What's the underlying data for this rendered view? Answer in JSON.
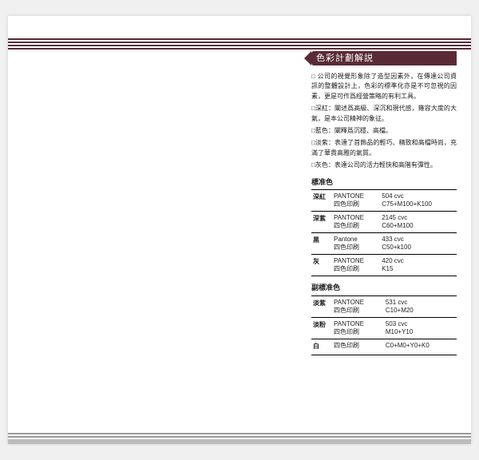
{
  "title": "色彩計劃解説",
  "intro": [
    "□ 公司的視覺形象除了造型因素外，在傳達公司資訊的整體設計上，色彩的標準化亦是不可忽視的因素，更是可作爲經營策略的有利工具。",
    "□深紅：闡述爲高級、深沉和現代感，雍容大度的大氣，是本公司精神的象征。",
    "□藍色：闡釋爲沉穩、高檔。",
    "□淡紫：表達了首飾品的輕巧、精致和高檔時尚，充滿了華貴高雅的氣質。",
    "□灰色：表達公司的活力輕快和高階有彈性。"
  ],
  "sections": [
    {
      "title": "標准色",
      "rows": [
        {
          "name": "深紅",
          "l1a": "PANTONE",
          "l1b": "504 cvc",
          "l2a": "四色印刷",
          "l2b": "C75+M100+K100"
        },
        {
          "name": "深紫",
          "l1a": "PANTONE",
          "l1b": "2145 cvc",
          "l2a": "四色印刷",
          "l2b": "C60+M100"
        },
        {
          "name": "黑",
          "l1a": "Pantone",
          "l1b": "433 cvc",
          "l2a": "四色印刷",
          "l2b": "C50+k100"
        },
        {
          "name": "灰",
          "l1a": "PANTONE",
          "l1b": "420 cvc",
          "l2a": "四色印刷",
          "l2b": "K15"
        }
      ]
    },
    {
      "title": "副標准色",
      "rows": [
        {
          "name": "淡紫",
          "l1a": "PANTONE",
          "l1b": "531 cvc",
          "l2a": "四色印刷",
          "l2b": "C10+M20"
        },
        {
          "name": "淡粉",
          "l1a": "PANTONE",
          "l1b": "503 cvc",
          "l2a": "四色印刷",
          "l2b": "M10+Y10"
        },
        {
          "name": "白",
          "l1a": "",
          "l1b": "",
          "l2a": "四色印刷",
          "l2b": "C0+M0+Y0+K0"
        }
      ]
    }
  ]
}
